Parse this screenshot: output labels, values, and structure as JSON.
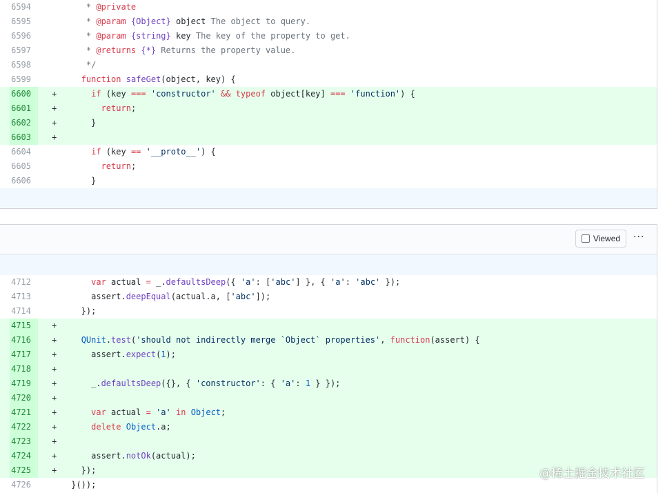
{
  "file1": {
    "lines": [
      {
        "num": "6594",
        "marker": "",
        "type": "ctx",
        "tokens": [
          [
            "cm",
            "    * "
          ],
          [
            "doc",
            "@private"
          ]
        ]
      },
      {
        "num": "6595",
        "marker": "",
        "type": "ctx",
        "tokens": [
          [
            "cm",
            "    * "
          ],
          [
            "doc",
            "@param"
          ],
          [
            "cm",
            " "
          ],
          [
            "type",
            "{Object}"
          ],
          [
            "plain",
            " object"
          ],
          [
            "cm",
            " The object to query."
          ]
        ]
      },
      {
        "num": "6596",
        "marker": "",
        "type": "ctx",
        "tokens": [
          [
            "cm",
            "    * "
          ],
          [
            "doc",
            "@param"
          ],
          [
            "cm",
            " "
          ],
          [
            "type",
            "{string}"
          ],
          [
            "plain",
            " key"
          ],
          [
            "cm",
            " The key of the property to get."
          ]
        ]
      },
      {
        "num": "6597",
        "marker": "",
        "type": "ctx",
        "tokens": [
          [
            "cm",
            "    * "
          ],
          [
            "doc",
            "@returns"
          ],
          [
            "cm",
            " "
          ],
          [
            "type",
            "{*}"
          ],
          [
            "cm",
            " Returns the property value."
          ]
        ]
      },
      {
        "num": "6598",
        "marker": "",
        "type": "ctx",
        "tokens": [
          [
            "cm",
            "    */"
          ]
        ]
      },
      {
        "num": "6599",
        "marker": "",
        "type": "ctx",
        "tokens": [
          [
            "plain",
            "   "
          ],
          [
            "kw",
            "function"
          ],
          [
            "plain",
            " "
          ],
          [
            "fn",
            "safeGet"
          ],
          [
            "plain",
            "(object, key) {"
          ]
        ]
      },
      {
        "num": "6600",
        "marker": "+",
        "type": "add",
        "tokens": [
          [
            "plain",
            "     "
          ],
          [
            "kw",
            "if"
          ],
          [
            "plain",
            " (key "
          ],
          [
            "kw",
            "==="
          ],
          [
            "plain",
            " "
          ],
          [
            "str",
            "'constructor'"
          ],
          [
            "plain",
            " "
          ],
          [
            "kw",
            "&&"
          ],
          [
            "plain",
            " "
          ],
          [
            "kw",
            "typeof"
          ],
          [
            "plain",
            " object[key] "
          ],
          [
            "kw",
            "==="
          ],
          [
            "plain",
            " "
          ],
          [
            "str",
            "'function'"
          ],
          [
            "plain",
            ") {"
          ]
        ]
      },
      {
        "num": "6601",
        "marker": "+",
        "type": "add",
        "tokens": [
          [
            "plain",
            "       "
          ],
          [
            "kw",
            "return"
          ],
          [
            "plain",
            ";"
          ]
        ]
      },
      {
        "num": "6602",
        "marker": "+",
        "type": "add",
        "tokens": [
          [
            "plain",
            "     }"
          ]
        ]
      },
      {
        "num": "6603",
        "marker": "+",
        "type": "add",
        "tokens": [
          [
            "plain",
            ""
          ]
        ]
      },
      {
        "num": "6604",
        "marker": "",
        "type": "ctx",
        "tokens": [
          [
            "plain",
            "     "
          ],
          [
            "kw",
            "if"
          ],
          [
            "plain",
            " (key "
          ],
          [
            "kw",
            "=="
          ],
          [
            "plain",
            " "
          ],
          [
            "str",
            "'__proto__'"
          ],
          [
            "plain",
            ") {"
          ]
        ]
      },
      {
        "num": "6605",
        "marker": "",
        "type": "ctx",
        "tokens": [
          [
            "plain",
            "       "
          ],
          [
            "kw",
            "return"
          ],
          [
            "plain",
            ";"
          ]
        ]
      },
      {
        "num": "6606",
        "marker": "",
        "type": "ctx",
        "tokens": [
          [
            "plain",
            "     }"
          ]
        ]
      }
    ]
  },
  "file2": {
    "viewed_label": "Viewed",
    "more_label": "···",
    "lines": [
      {
        "num": "4712",
        "marker": "",
        "type": "ctx",
        "tokens": [
          [
            "plain",
            "     "
          ],
          [
            "kw",
            "var"
          ],
          [
            "plain",
            " actual "
          ],
          [
            "kw",
            "="
          ],
          [
            "plain",
            " _."
          ],
          [
            "fn",
            "defaultsDeep"
          ],
          [
            "plain",
            "({ "
          ],
          [
            "str",
            "'a'"
          ],
          [
            "plain",
            ": ["
          ],
          [
            "str",
            "'abc'"
          ],
          [
            "plain",
            "] }, { "
          ],
          [
            "str",
            "'a'"
          ],
          [
            "plain",
            ": "
          ],
          [
            "str",
            "'abc'"
          ],
          [
            "plain",
            " });"
          ]
        ]
      },
      {
        "num": "4713",
        "marker": "",
        "type": "ctx",
        "tokens": [
          [
            "plain",
            "     assert."
          ],
          [
            "fn",
            "deepEqual"
          ],
          [
            "plain",
            "(actual.a, ["
          ],
          [
            "str",
            "'abc'"
          ],
          [
            "plain",
            "]);"
          ]
        ]
      },
      {
        "num": "4714",
        "marker": "",
        "type": "ctx",
        "tokens": [
          [
            "plain",
            "   });"
          ]
        ]
      },
      {
        "num": "4715",
        "marker": "+",
        "type": "add",
        "tokens": [
          [
            "plain",
            ""
          ]
        ]
      },
      {
        "num": "4716",
        "marker": "+",
        "type": "add",
        "tokens": [
          [
            "plain",
            "   "
          ],
          [
            "const",
            "QUnit"
          ],
          [
            "plain",
            "."
          ],
          [
            "fn",
            "test"
          ],
          [
            "plain",
            "("
          ],
          [
            "str",
            "'should not indirectly merge `Object` properties'"
          ],
          [
            "plain",
            ", "
          ],
          [
            "kw",
            "function"
          ],
          [
            "plain",
            "(assert) {"
          ]
        ]
      },
      {
        "num": "4717",
        "marker": "+",
        "type": "add",
        "tokens": [
          [
            "plain",
            "     assert."
          ],
          [
            "fn",
            "expect"
          ],
          [
            "plain",
            "("
          ],
          [
            "num",
            "1"
          ],
          [
            "plain",
            ");"
          ]
        ]
      },
      {
        "num": "4718",
        "marker": "+",
        "type": "add",
        "tokens": [
          [
            "plain",
            ""
          ]
        ]
      },
      {
        "num": "4719",
        "marker": "+",
        "type": "add",
        "tokens": [
          [
            "plain",
            "     _."
          ],
          [
            "fn",
            "defaultsDeep"
          ],
          [
            "plain",
            "({}, { "
          ],
          [
            "str",
            "'constructor'"
          ],
          [
            "plain",
            ": { "
          ],
          [
            "str",
            "'a'"
          ],
          [
            "plain",
            ": "
          ],
          [
            "num",
            "1"
          ],
          [
            "plain",
            " } });"
          ]
        ]
      },
      {
        "num": "4720",
        "marker": "+",
        "type": "add",
        "tokens": [
          [
            "plain",
            ""
          ]
        ]
      },
      {
        "num": "4721",
        "marker": "+",
        "type": "add",
        "tokens": [
          [
            "plain",
            "     "
          ],
          [
            "kw",
            "var"
          ],
          [
            "plain",
            " actual "
          ],
          [
            "kw",
            "="
          ],
          [
            "plain",
            " "
          ],
          [
            "str",
            "'a'"
          ],
          [
            "plain",
            " "
          ],
          [
            "kw",
            "in"
          ],
          [
            "plain",
            " "
          ],
          [
            "const",
            "Object"
          ],
          [
            "plain",
            ";"
          ]
        ]
      },
      {
        "num": "4722",
        "marker": "+",
        "type": "add",
        "tokens": [
          [
            "plain",
            "     "
          ],
          [
            "kw",
            "delete"
          ],
          [
            "plain",
            " "
          ],
          [
            "const",
            "Object"
          ],
          [
            "plain",
            ".a;"
          ]
        ]
      },
      {
        "num": "4723",
        "marker": "+",
        "type": "add",
        "tokens": [
          [
            "plain",
            ""
          ]
        ]
      },
      {
        "num": "4724",
        "marker": "+",
        "type": "add",
        "tokens": [
          [
            "plain",
            "     assert."
          ],
          [
            "fn",
            "notOk"
          ],
          [
            "plain",
            "(actual);"
          ]
        ]
      },
      {
        "num": "4725",
        "marker": "+",
        "type": "add",
        "tokens": [
          [
            "plain",
            "   });"
          ]
        ]
      },
      {
        "num": "4726",
        "marker": "",
        "type": "ctx",
        "tokens": [
          [
            "plain",
            " }());"
          ]
        ]
      }
    ]
  },
  "watermark": "@稀土掘金技术社区"
}
